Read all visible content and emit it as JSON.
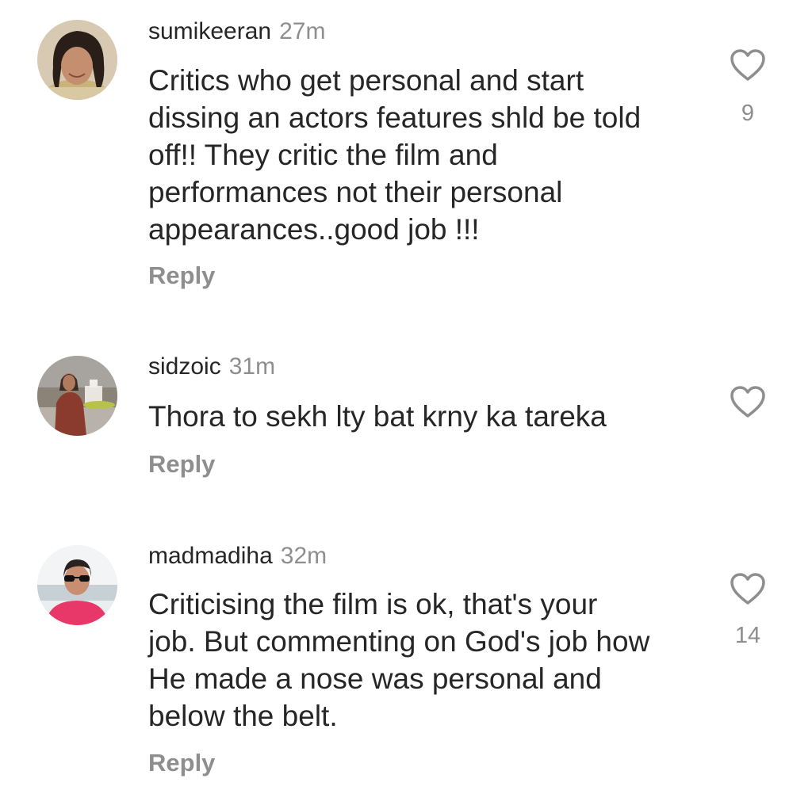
{
  "comments": [
    {
      "username": "sumikeeran",
      "time": "27m",
      "text_lines": [
        "Critics who get personal and start",
        "dissing an actors features shld be told",
        "off!! They critic the film and",
        "performances not their personal",
        "appearances..good job !!!"
      ],
      "likes": "9",
      "reply_label": "Reply",
      "avatar_icon": "profile-photo-woman-smiling",
      "like_icon": "heart-outline-icon"
    },
    {
      "username": "sidzoic",
      "time": "31m",
      "text_lines": [
        "Thora to sekh lty bat krny ka tareka"
      ],
      "likes": "",
      "reply_label": "Reply",
      "avatar_icon": "profile-photo-person-outdoors",
      "like_icon": "heart-outline-icon"
    },
    {
      "username": "madmadiha",
      "time": "32m",
      "text_lines": [
        "Criticising the film is ok, that's your",
        "job. But commenting on God's job how",
        "He made a nose was personal and",
        "below the belt."
      ],
      "likes": "14",
      "reply_label": "Reply",
      "avatar_icon": "profile-photo-woman-sunglasses",
      "like_icon": "heart-outline-icon"
    }
  ]
}
